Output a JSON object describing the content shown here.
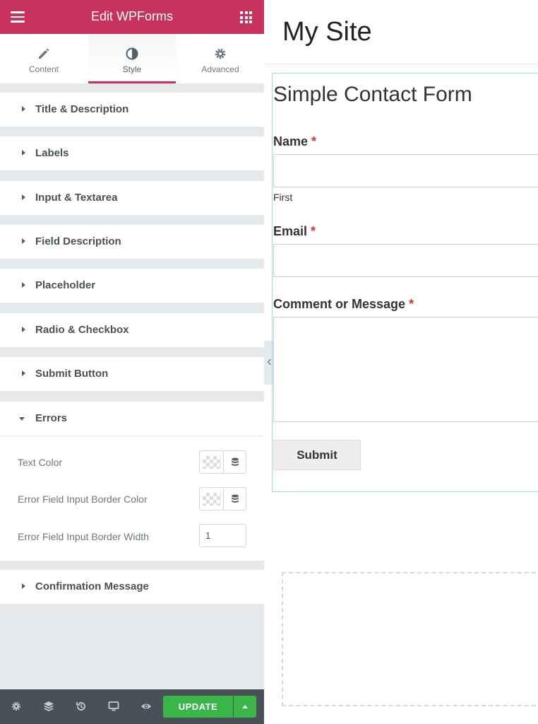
{
  "panel": {
    "title": "Edit WPForms",
    "tabs": [
      {
        "label": "Content",
        "icon": "pencil-icon"
      },
      {
        "label": "Style",
        "icon": "contrast-icon",
        "active": true
      },
      {
        "label": "Advanced",
        "icon": "gear-icon"
      }
    ],
    "sections": [
      {
        "label": "Title & Description"
      },
      {
        "label": "Labels"
      },
      {
        "label": "Input & Textarea"
      },
      {
        "label": "Field Description"
      },
      {
        "label": "Placeholder"
      },
      {
        "label": "Radio & Checkbox"
      },
      {
        "label": "Submit Button"
      },
      {
        "label": "Errors",
        "expanded": true
      },
      {
        "label": "Confirmation Message"
      }
    ],
    "errors_controls": {
      "text_color_label": "Text Color",
      "border_color_label": "Error Field Input Border Color",
      "border_width_label": "Error Field Input Border Width",
      "border_width_value": "1"
    },
    "footer": {
      "update_label": "UPDATE"
    }
  },
  "preview": {
    "site_title": "My Site",
    "form_title": "Simple Contact Form",
    "fields": [
      {
        "label": "Name",
        "required_mark": "*",
        "sublabel": "First"
      },
      {
        "label": "Email",
        "required_mark": "*"
      },
      {
        "label": "Comment or Message",
        "required_mark": "*"
      }
    ],
    "submit_label": "Submit"
  },
  "colors": {
    "accent": "#c9325f",
    "update_green": "#39b54a",
    "footer_dark": "#495157",
    "panel_bg": "#e6e9ec",
    "required_red": "#d63638"
  }
}
